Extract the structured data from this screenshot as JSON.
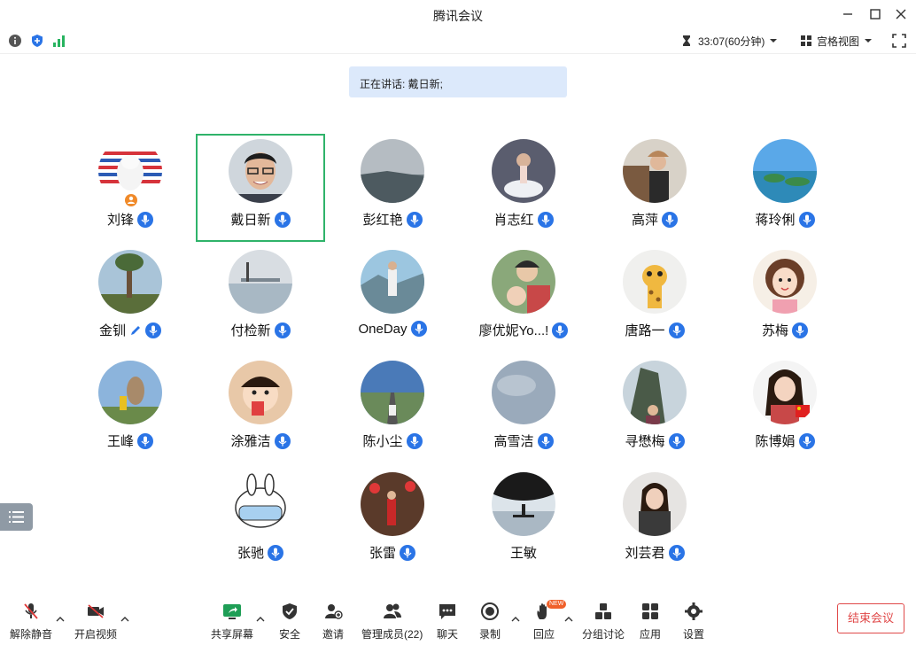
{
  "window": {
    "title": "腾讯会议"
  },
  "topbar": {
    "timer": "33:07(60分钟)",
    "view_mode": "宫格视图"
  },
  "speaking": {
    "text": "正在讲话: 戴日新;"
  },
  "participants": [
    {
      "name": "刘锋"
    },
    {
      "name": "戴日新"
    },
    {
      "name": "彭红艳"
    },
    {
      "name": "肖志红"
    },
    {
      "name": "高萍"
    },
    {
      "name": "蒋玲俐"
    },
    {
      "name": "金钏"
    },
    {
      "name": "付检新"
    },
    {
      "name": "OneDay"
    },
    {
      "name": "廖优妮Yo...!"
    },
    {
      "name": "唐路一"
    },
    {
      "name": "苏梅"
    },
    {
      "name": "王峰"
    },
    {
      "name": "涂雅洁"
    },
    {
      "name": "陈小尘"
    },
    {
      "name": "高雪洁"
    },
    {
      "name": "寻懋梅"
    },
    {
      "name": "陈博娟"
    },
    {
      "name": "张驰"
    },
    {
      "name": "张雷"
    },
    {
      "name": "王敏"
    },
    {
      "name": "刘芸君"
    }
  ],
  "toolbar": {
    "unmute": "解除静音",
    "start_video": "开启视频",
    "share_screen": "共享屏幕",
    "security": "安全",
    "invite": "邀请",
    "manage_members": "管理成员(22)",
    "chat": "聊天",
    "record": "录制",
    "reactions": "回应",
    "new_badge": "NEW",
    "breakout": "分组讨论",
    "apps": "应用",
    "settings": "设置",
    "end_meeting": "结束会议"
  },
  "colors": {
    "accent": "#2a74e6",
    "active_border": "#2fb36a",
    "end_red": "#e04848",
    "speaking_bg": "#dce9fb"
  }
}
